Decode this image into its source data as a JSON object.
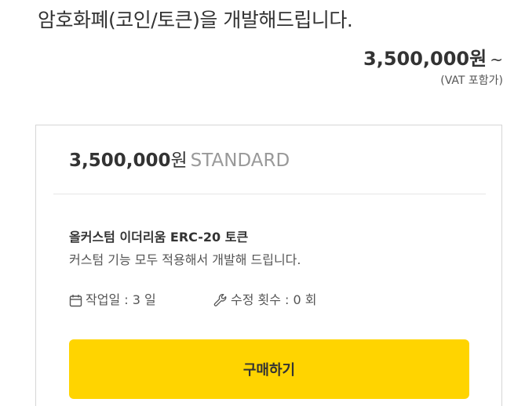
{
  "header": {
    "title": "암호화폐(코인/토큰)을 개발해드립니다.",
    "price_amount": "3,500,000",
    "price_unit": "원",
    "price_suffix": "~",
    "vat_note": "(VAT 포함가)"
  },
  "package": {
    "price_amount": "3,500,000",
    "price_unit": "원",
    "tier": "STANDARD",
    "title": "올커스텀 이더리움 ERC-20 토큰",
    "description": "커스텀 기능 모두 적용해서 개발해 드립니다.",
    "work_days_label": "작업일 : 3 일",
    "revisions_label": "수정 횟수 : 0 회",
    "buy_label": "구매하기"
  },
  "icons": {
    "calendar": "calendar-icon",
    "wrench": "wrench-icon"
  },
  "colors": {
    "accent": "#ffd400",
    "text": "#333333",
    "muted": "#999999",
    "border": "#d6d6d6"
  }
}
